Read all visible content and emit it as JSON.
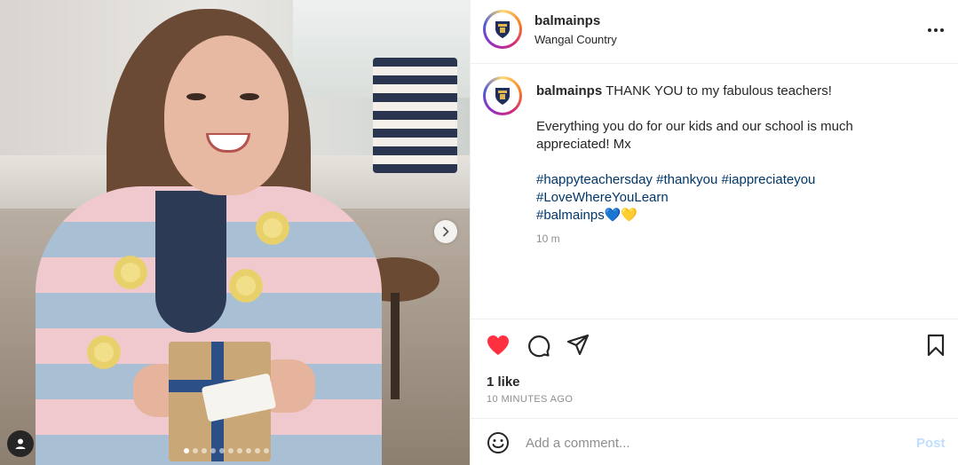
{
  "post": {
    "username": "balmainps",
    "location": "Wangal Country",
    "more_icon": "more-horizontal-icon"
  },
  "caption": {
    "username": "balmainps",
    "line1": "THANK YOU to my fabulous teachers!",
    "line2": "Everything you do for our kids and our school is much appreciated! Mx",
    "hashtags_line1": "#happyteachersday #thankyou #iappreciateyou",
    "hashtags_line2": "#LoveWhereYouLearn",
    "hashtags_line3": "#balmainps💙💛",
    "time": "10 m"
  },
  "media": {
    "carousel_total": 10,
    "carousel_active": 1,
    "next_icon": "chevron-right-icon",
    "tag_icon": "user-tag-icon"
  },
  "actions": {
    "like_icon": "heart-filled-icon",
    "comment_icon": "comment-icon",
    "share_icon": "share-icon",
    "save_icon": "bookmark-icon",
    "liked_color": "#ff3040"
  },
  "stats": {
    "likes": "1 like",
    "posted": "10 MINUTES AGO"
  },
  "comment": {
    "placeholder": "Add a comment...",
    "post_label": "Post",
    "emoji_icon": "emoji-icon"
  }
}
